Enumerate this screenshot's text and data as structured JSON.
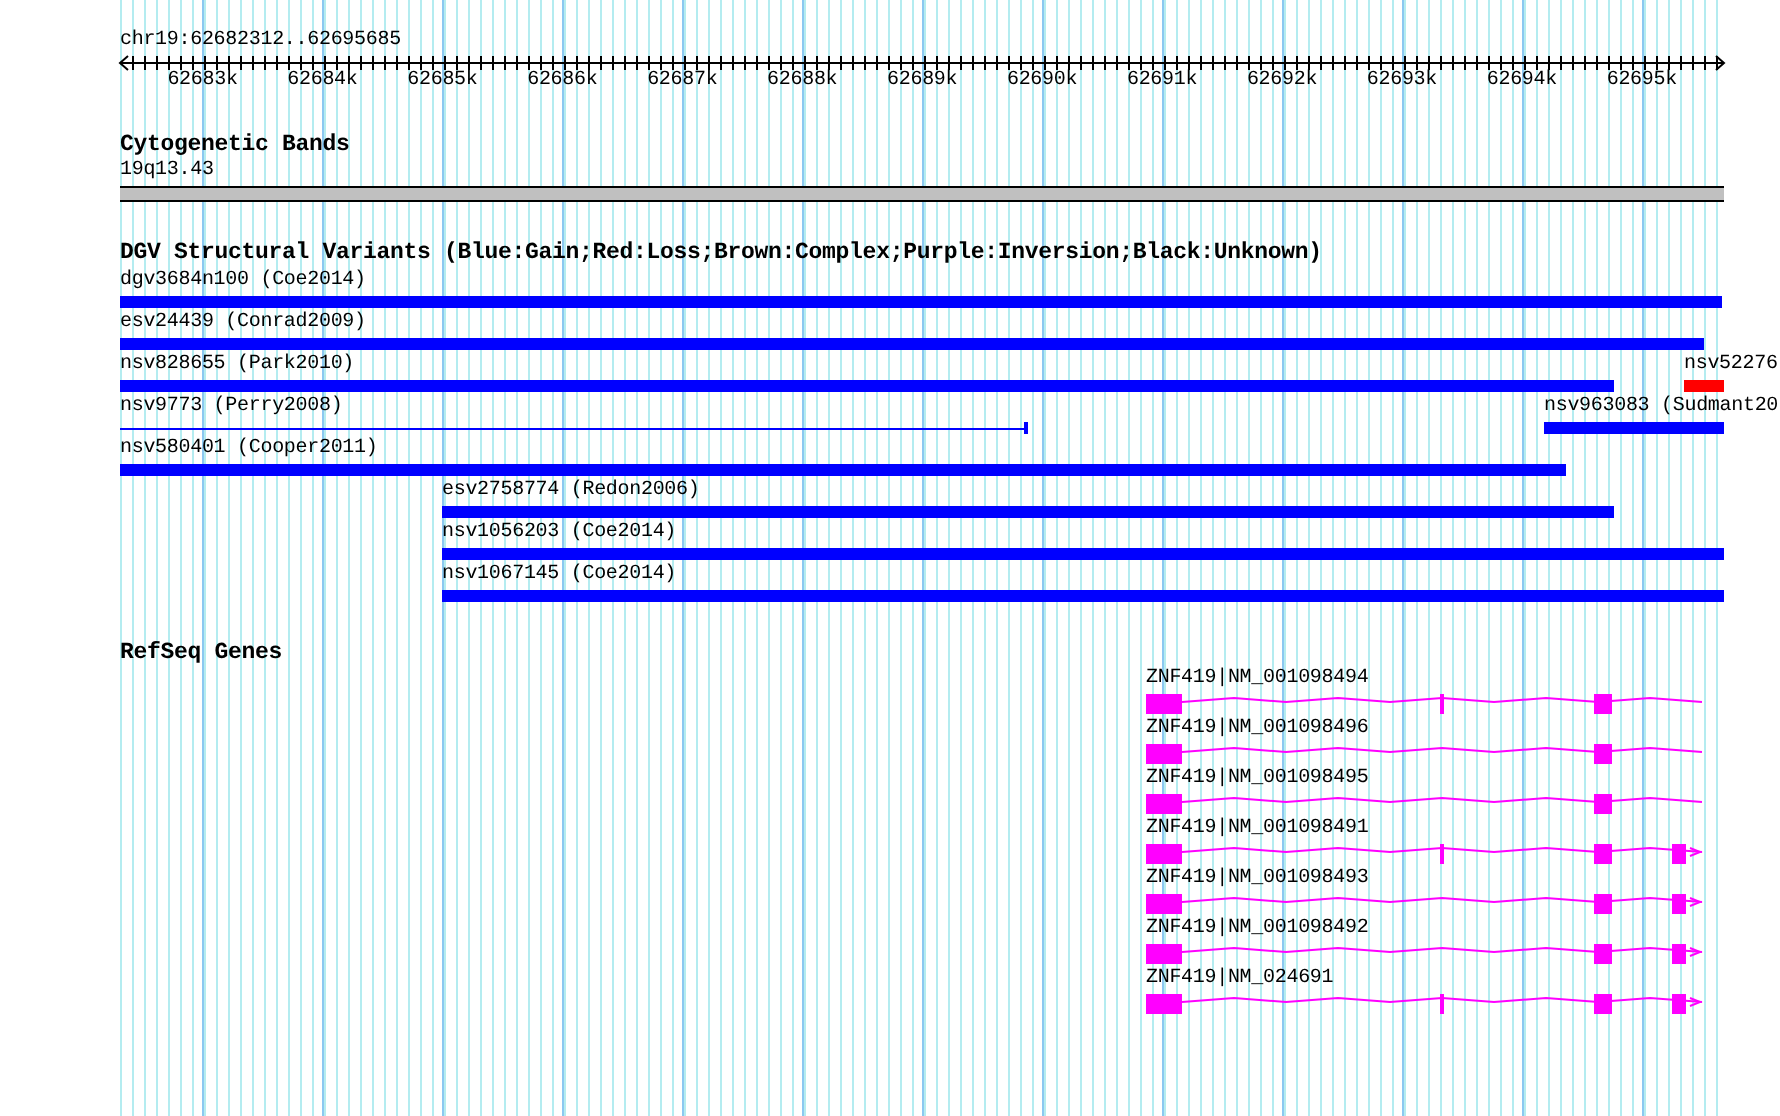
{
  "ruler": {
    "location": "chr19:62682312..62695685",
    "ticks": [
      "62683k",
      "62684k",
      "62685k",
      "62686k",
      "62687k",
      "62688k",
      "62689k",
      "62690k",
      "62691k",
      "62692k",
      "62693k",
      "62694k",
      "62695k"
    ]
  },
  "cytoband_track": {
    "title": "Cytogenetic Bands",
    "band": "19q13.43"
  },
  "variant_track": {
    "title": "DGV Structural Variants (Blue:Gain;Red:Loss;Brown:Complex;Purple:Inversion;Black:Unknown)",
    "variants": [
      {
        "label": "dgv3684n100 (Coe2014)",
        "color": "#0000ff",
        "kind": "bar"
      },
      {
        "label": "esv24439 (Conrad2009)",
        "color": "#0000ff",
        "kind": "bar"
      },
      {
        "label": "nsv828655 (Park2010)",
        "color": "#0000ff",
        "kind": "bar"
      },
      {
        "label": "nsv52276",
        "color": "#ff0000",
        "kind": "bar"
      },
      {
        "label": "nsv9773 (Perry2008)",
        "color": "#0000ff",
        "kind": "line"
      },
      {
        "label": "nsv963083 (Sudmant20",
        "color": "#0000ff",
        "kind": "bar"
      },
      {
        "label": "nsv580401 (Cooper2011)",
        "color": "#0000ff",
        "kind": "bar"
      },
      {
        "label": "esv2758774 (Redon2006)",
        "color": "#0000ff",
        "kind": "bar"
      },
      {
        "label": "nsv1056203 (Coe2014)",
        "color": "#0000ff",
        "kind": "bar"
      },
      {
        "label": "nsv1067145 (Coe2014)",
        "color": "#0000ff",
        "kind": "bar"
      }
    ]
  },
  "gene_track": {
    "title": "RefSeq Genes",
    "genes": [
      {
        "label": "ZNF419|NM_001098494"
      },
      {
        "label": "ZNF419|NM_001098496"
      },
      {
        "label": "ZNF419|NM_001098495"
      },
      {
        "label": "ZNF419|NM_001098491"
      },
      {
        "label": "ZNF419|NM_001098493"
      },
      {
        "label": "ZNF419|NM_001098492"
      },
      {
        "label": "ZNF419|NM_024691"
      }
    ]
  }
}
